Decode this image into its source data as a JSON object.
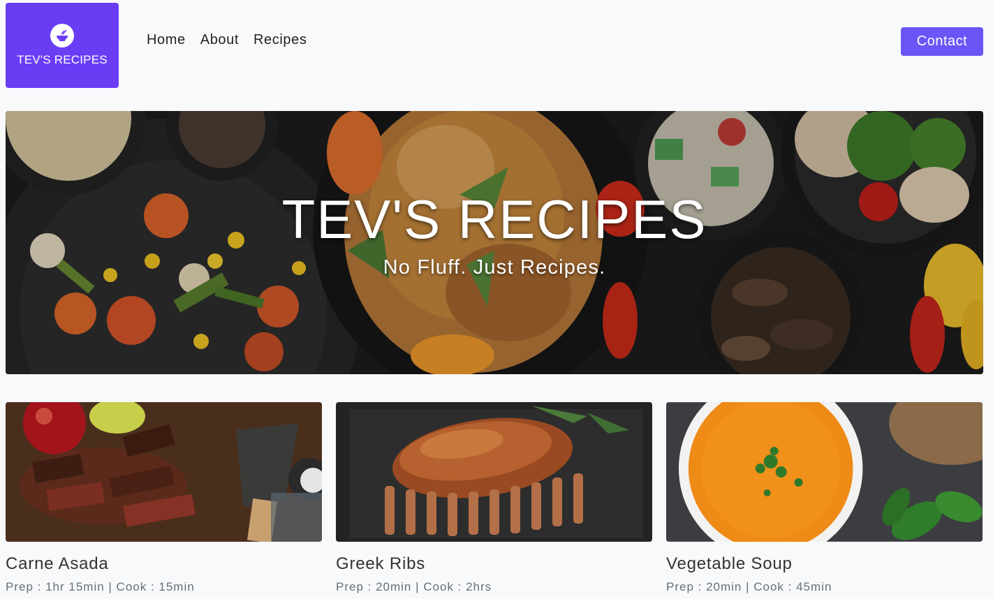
{
  "brand": {
    "logo_text": "TEV'S RECIPES",
    "logo_icon": "bowl-icon",
    "accent": "#6a3df5"
  },
  "nav": {
    "items": [
      {
        "label": "Home"
      },
      {
        "label": "About"
      },
      {
        "label": "Recipes"
      }
    ],
    "contact_label": "Contact",
    "contact_color": "#6a55f7"
  },
  "hero": {
    "title": "TEV'S RECIPES",
    "subtitle": "No Fluff. Just Recipes."
  },
  "recipes": [
    {
      "title": "Carne Asada",
      "meta": "Prep : 1hr 15min | Cook : 15min"
    },
    {
      "title": "Greek Ribs",
      "meta": "Prep : 20min | Cook : 2hrs"
    },
    {
      "title": "Vegetable Soup",
      "meta": "Prep : 20min | Cook : 45min"
    }
  ]
}
